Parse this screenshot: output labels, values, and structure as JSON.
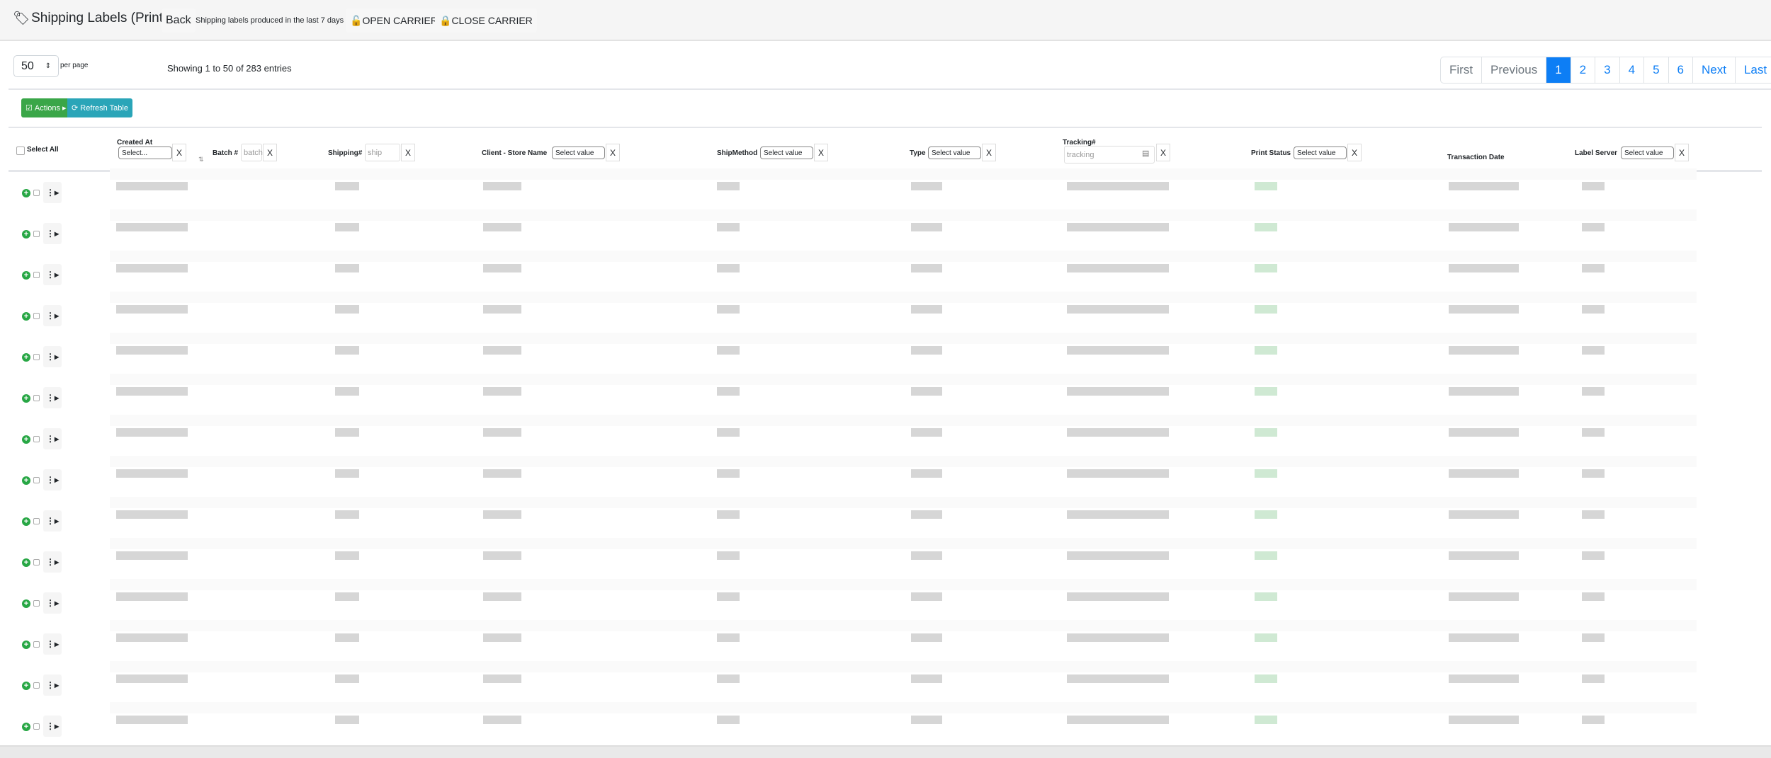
{
  "header": {
    "title": "Shipping Labels (Print Out)",
    "back": "Back",
    "subtitle": "Shipping labels produced in the last 7 days",
    "open_carrier": "OPEN CARRIER",
    "close_carrier": "CLOSE CARRIER"
  },
  "controls": {
    "per_page_value": "50",
    "per_page_label": "per page",
    "showing": "Showing 1 to 50 of 283 entries"
  },
  "pagination": {
    "items": [
      "First",
      "Previous",
      "1",
      "2",
      "3",
      "4",
      "5",
      "6",
      "Next",
      "Last"
    ],
    "active": "1"
  },
  "toolbar": {
    "actions": "Actions",
    "refresh": "Refresh Table",
    "actions_color": "#3aa648",
    "refresh_color": "#2aa5b8"
  },
  "columns": {
    "select_all": "Select All",
    "created_at": {
      "label": "Created At",
      "select": "Select...",
      "clear": "X"
    },
    "batch": {
      "label": "Batch #",
      "placeholder": "batch",
      "clear": "X"
    },
    "shipping": {
      "label": "Shipping#",
      "placeholder": "ship",
      "clear": "X"
    },
    "client": {
      "label": "Client - Store Name",
      "select": "Select value",
      "clear": "X"
    },
    "shipmethod": {
      "label": "ShipMethod",
      "select": "Select value",
      "clear": "X"
    },
    "type": {
      "label": "Type",
      "select": "Select value",
      "clear": "X"
    },
    "tracking": {
      "label": "Tracking#",
      "placeholder": "tracking",
      "clear": "X"
    },
    "print_status": {
      "label": "Print Status",
      "select": "Select value",
      "clear": "X"
    },
    "transaction_date": {
      "label": "Transaction Date"
    },
    "label_server": {
      "label": "Label Server",
      "select": "Select value",
      "clear": "X"
    }
  }
}
